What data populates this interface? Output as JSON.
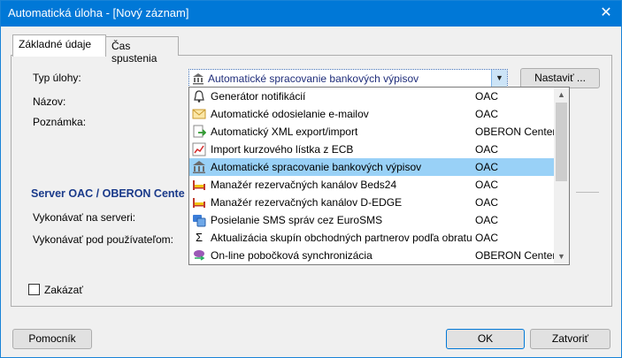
{
  "window": {
    "title": "Automatická úloha - [Nový záznam]",
    "close_glyph": "✕"
  },
  "tabs": [
    {
      "label": "Základné údaje",
      "active": true
    },
    {
      "label": "Čas spustenia",
      "active": false
    }
  ],
  "form": {
    "task_type_label": "Typ úlohy:",
    "task_type_value": "Automatické spracovanie bankových výpisov",
    "settings_button": "Nastaviť ...",
    "name_label": "Názov:",
    "note_label": "Poznámka:",
    "section_title": "Server OAC  / OBERON Cente",
    "run_on_server_label": "Vykonávať na serveri:",
    "run_as_user_label": "Vykonávať pod používateľom:",
    "disable_label": "Zakázať",
    "disable_checked": false
  },
  "dropdown": {
    "items": [
      {
        "name": "Generátor notifikácií",
        "module": "OAC",
        "icon": "bell-icon",
        "selected": false
      },
      {
        "name": "Automatické odosielanie e-mailov",
        "module": "OAC",
        "icon": "envelope-icon",
        "selected": false
      },
      {
        "name": "Automatický XML export/import",
        "module": "OBERON Center",
        "icon": "xml-export-icon",
        "selected": false
      },
      {
        "name": "Import kurzového lístka z ECB",
        "module": "OAC",
        "icon": "chart-icon",
        "selected": false
      },
      {
        "name": "Automatické spracovanie bankových výpisov",
        "module": "OAC",
        "icon": "bank-icon",
        "selected": true
      },
      {
        "name": "Manažér rezervačných kanálov Beds24",
        "module": "OAC",
        "icon": "bed-icon",
        "selected": false
      },
      {
        "name": "Manažér rezervačných kanálov D-EDGE",
        "module": "OAC",
        "icon": "bed-icon",
        "selected": false
      },
      {
        "name": "Posielanie SMS správ cez EuroSMS",
        "module": "OAC",
        "icon": "sms-icon",
        "selected": false
      },
      {
        "name": "Aktualizácia skupín obchodných partnerov podľa obratu",
        "module": "OAC",
        "icon": "sigma-icon",
        "selected": false
      },
      {
        "name": "On-line pobočková synchronizácia",
        "module": "OBERON Center",
        "icon": "sync-icon",
        "selected": false
      }
    ]
  },
  "footer": {
    "help_button": "Pomocník",
    "ok_button": "OK",
    "cancel_button": "Zatvoriť"
  },
  "colors": {
    "titlebar": "#0078d7",
    "selected_row": "#99d1f7",
    "section_title": "#1a3a8a"
  }
}
